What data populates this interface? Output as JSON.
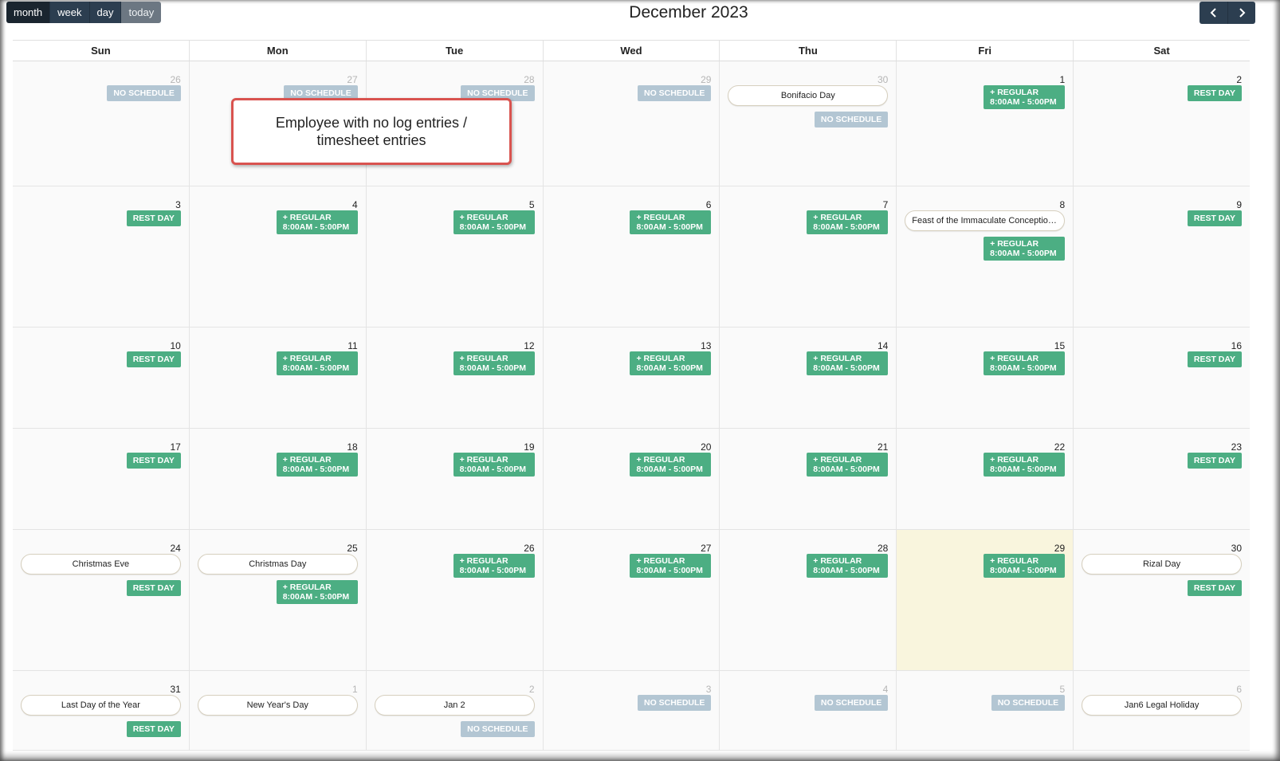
{
  "toolbar": {
    "views": [
      "month",
      "week",
      "day"
    ],
    "today_label": "today",
    "title": "December 2023"
  },
  "weekdays": [
    "Sun",
    "Mon",
    "Tue",
    "Wed",
    "Thu",
    "Fri",
    "Sat"
  ],
  "labels": {
    "rest": "REST DAY",
    "nosched": "NO SCHEDULE",
    "regular_line1": "+ REGULAR",
    "regular_line2": "8:00AM - 5:00PM"
  },
  "callout": "Employee with no log entries / timesheet entries",
  "weeks": [
    [
      {
        "n": "26",
        "other": true,
        "events": [
          {
            "t": "nosched"
          }
        ]
      },
      {
        "n": "27",
        "other": true,
        "events": [
          {
            "t": "nosched"
          }
        ]
      },
      {
        "n": "28",
        "other": true,
        "events": [
          {
            "t": "nosched"
          }
        ]
      },
      {
        "n": "29",
        "other": true,
        "events": [
          {
            "t": "nosched"
          }
        ]
      },
      {
        "n": "30",
        "other": true,
        "events": [
          {
            "t": "holiday",
            "label": "Bonifacio Day"
          },
          {
            "t": "nosched"
          }
        ]
      },
      {
        "n": "1",
        "events": [
          {
            "t": "regular"
          }
        ]
      },
      {
        "n": "2",
        "events": [
          {
            "t": "rest"
          }
        ]
      }
    ],
    [
      {
        "n": "3",
        "events": [
          {
            "t": "rest"
          }
        ]
      },
      {
        "n": "4",
        "events": [
          {
            "t": "regular"
          }
        ]
      },
      {
        "n": "5",
        "events": [
          {
            "t": "regular"
          }
        ]
      },
      {
        "n": "6",
        "events": [
          {
            "t": "regular"
          }
        ]
      },
      {
        "n": "7",
        "events": [
          {
            "t": "regular"
          }
        ]
      },
      {
        "n": "8",
        "events": [
          {
            "t": "holiday",
            "label": "Feast of the Immaculate Conception ..."
          },
          {
            "t": "regular"
          }
        ]
      },
      {
        "n": "9",
        "events": [
          {
            "t": "rest"
          }
        ]
      }
    ],
    [
      {
        "n": "10",
        "events": [
          {
            "t": "rest"
          }
        ]
      },
      {
        "n": "11",
        "events": [
          {
            "t": "regular"
          }
        ]
      },
      {
        "n": "12",
        "events": [
          {
            "t": "regular"
          }
        ]
      },
      {
        "n": "13",
        "events": [
          {
            "t": "regular"
          }
        ]
      },
      {
        "n": "14",
        "events": [
          {
            "t": "regular"
          }
        ]
      },
      {
        "n": "15",
        "events": [
          {
            "t": "regular"
          }
        ]
      },
      {
        "n": "16",
        "events": [
          {
            "t": "rest"
          }
        ]
      }
    ],
    [
      {
        "n": "17",
        "events": [
          {
            "t": "rest"
          }
        ]
      },
      {
        "n": "18",
        "events": [
          {
            "t": "regular"
          }
        ]
      },
      {
        "n": "19",
        "events": [
          {
            "t": "regular"
          }
        ]
      },
      {
        "n": "20",
        "events": [
          {
            "t": "regular"
          }
        ]
      },
      {
        "n": "21",
        "events": [
          {
            "t": "regular"
          }
        ]
      },
      {
        "n": "22",
        "events": [
          {
            "t": "regular"
          }
        ]
      },
      {
        "n": "23",
        "events": [
          {
            "t": "rest"
          }
        ]
      }
    ],
    [
      {
        "n": "24",
        "events": [
          {
            "t": "holiday",
            "label": "Christmas Eve"
          },
          {
            "t": "rest"
          }
        ]
      },
      {
        "n": "25",
        "events": [
          {
            "t": "holiday",
            "label": "Christmas Day"
          },
          {
            "t": "regular"
          }
        ]
      },
      {
        "n": "26",
        "events": [
          {
            "t": "regular"
          }
        ]
      },
      {
        "n": "27",
        "events": [
          {
            "t": "regular"
          }
        ]
      },
      {
        "n": "28",
        "events": [
          {
            "t": "regular"
          }
        ]
      },
      {
        "n": "29",
        "today": true,
        "events": [
          {
            "t": "regular"
          }
        ]
      },
      {
        "n": "30",
        "events": [
          {
            "t": "holiday",
            "label": "Rizal Day"
          },
          {
            "t": "rest"
          }
        ]
      }
    ],
    [
      {
        "n": "31",
        "events": [
          {
            "t": "holiday",
            "label": "Last Day of the Year"
          },
          {
            "t": "rest"
          }
        ]
      },
      {
        "n": "1",
        "other": true,
        "events": [
          {
            "t": "holiday",
            "label": "New Year's Day"
          }
        ]
      },
      {
        "n": "2",
        "other": true,
        "events": [
          {
            "t": "holiday",
            "label": "Jan 2"
          },
          {
            "t": "nosched"
          }
        ]
      },
      {
        "n": "3",
        "other": true,
        "events": [
          {
            "t": "nosched"
          }
        ]
      },
      {
        "n": "4",
        "other": true,
        "events": [
          {
            "t": "nosched"
          }
        ]
      },
      {
        "n": "5",
        "other": true,
        "events": [
          {
            "t": "nosched"
          }
        ]
      },
      {
        "n": "6",
        "other": true,
        "events": [
          {
            "t": "holiday",
            "label": "Jan6 Legal Holiday"
          }
        ]
      }
    ]
  ]
}
